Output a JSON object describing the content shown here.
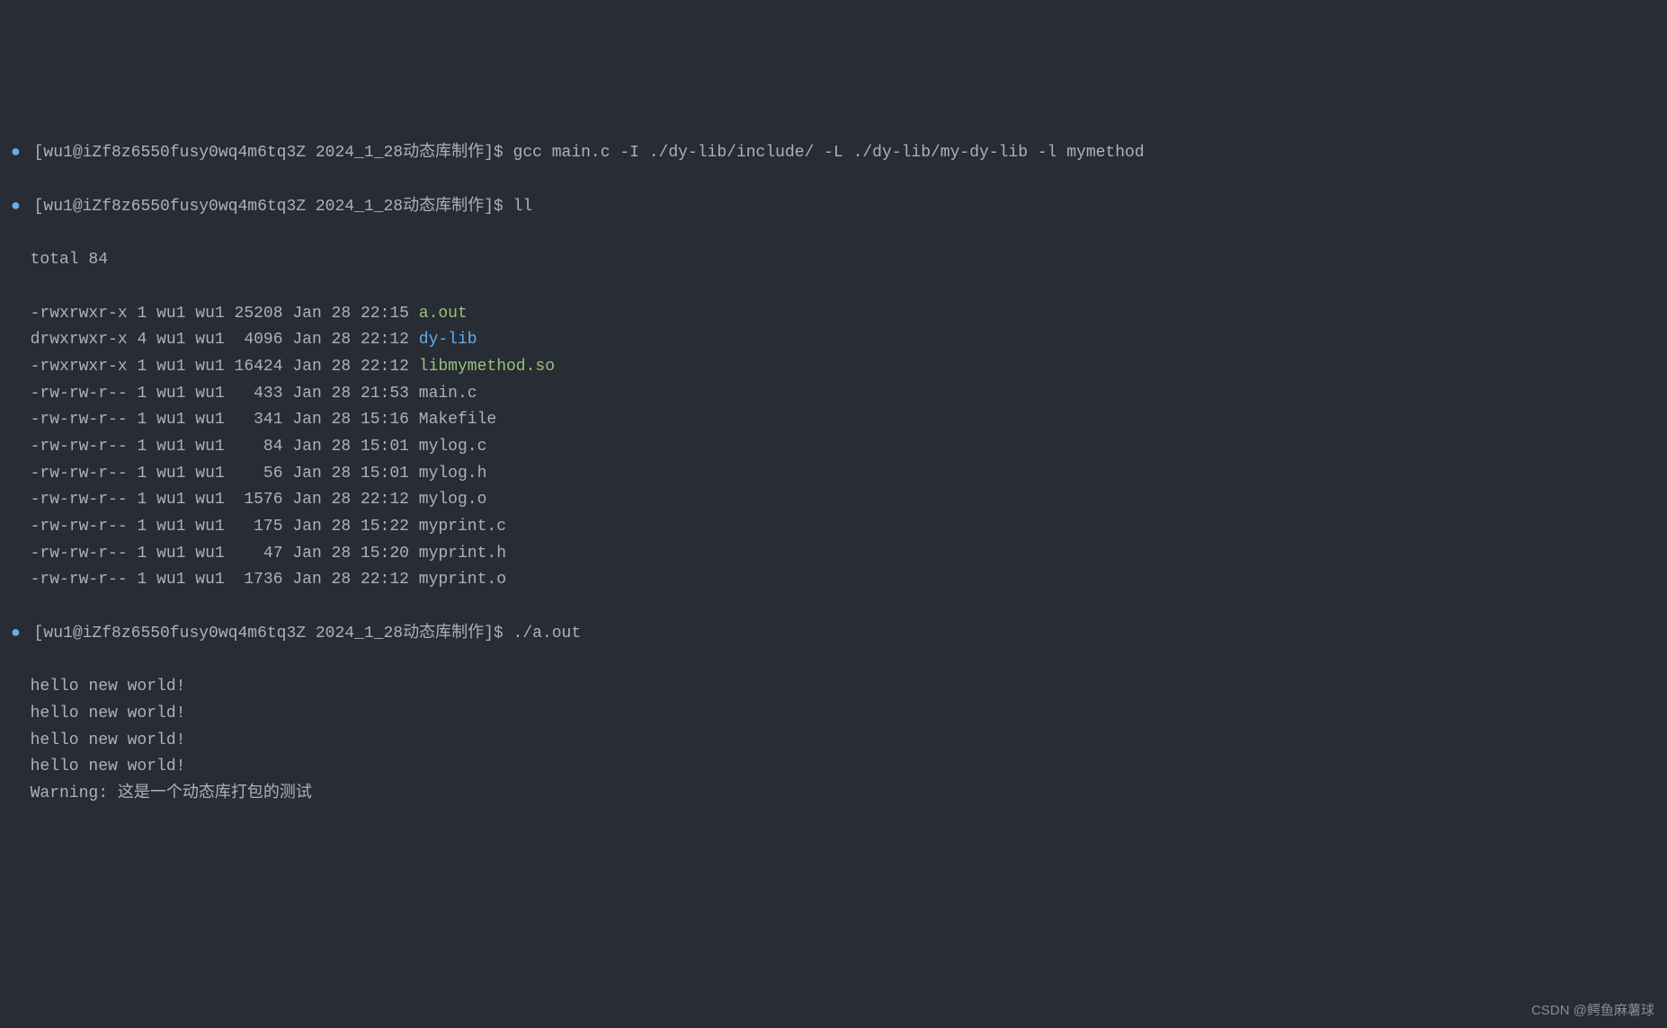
{
  "bullet": "●",
  "prompt": "[wu1@iZf8z6550fusy0wq4m6tq3Z 2024_1_28动态库制作]$",
  "commands": {
    "gcc": "gcc main.c -I ./dy-lib/include/ -L ./dy-lib/my-dy-lib -l mymethod",
    "ll": "ll",
    "run": "./a.out"
  },
  "total": "total 84",
  "files": [
    {
      "perm": "-rwxrwxr-x",
      "links": "1",
      "owner": "wu1",
      "group": "wu1",
      "size": "25208",
      "date": "Jan 28 22:15",
      "name": "a.out",
      "type": "exec"
    },
    {
      "perm": "drwxrwxr-x",
      "links": "4",
      "owner": "wu1",
      "group": "wu1",
      "size": " 4096",
      "date": "Jan 28 22:12",
      "name": "dy-lib",
      "type": "dir"
    },
    {
      "perm": "-rwxrwxr-x",
      "links": "1",
      "owner": "wu1",
      "group": "wu1",
      "size": "16424",
      "date": "Jan 28 22:12",
      "name": "libmymethod.so",
      "type": "exec"
    },
    {
      "perm": "-rw-rw-r--",
      "links": "1",
      "owner": "wu1",
      "group": "wu1",
      "size": "  433",
      "date": "Jan 28 21:53",
      "name": "main.c",
      "type": "normal"
    },
    {
      "perm": "-rw-rw-r--",
      "links": "1",
      "owner": "wu1",
      "group": "wu1",
      "size": "  341",
      "date": "Jan 28 15:16",
      "name": "Makefile",
      "type": "normal"
    },
    {
      "perm": "-rw-rw-r--",
      "links": "1",
      "owner": "wu1",
      "group": "wu1",
      "size": "   84",
      "date": "Jan 28 15:01",
      "name": "mylog.c",
      "type": "normal"
    },
    {
      "perm": "-rw-rw-r--",
      "links": "1",
      "owner": "wu1",
      "group": "wu1",
      "size": "   56",
      "date": "Jan 28 15:01",
      "name": "mylog.h",
      "type": "normal"
    },
    {
      "perm": "-rw-rw-r--",
      "links": "1",
      "owner": "wu1",
      "group": "wu1",
      "size": " 1576",
      "date": "Jan 28 22:12",
      "name": "mylog.o",
      "type": "normal"
    },
    {
      "perm": "-rw-rw-r--",
      "links": "1",
      "owner": "wu1",
      "group": "wu1",
      "size": "  175",
      "date": "Jan 28 15:22",
      "name": "myprint.c",
      "type": "normal"
    },
    {
      "perm": "-rw-rw-r--",
      "links": "1",
      "owner": "wu1",
      "group": "wu1",
      "size": "   47",
      "date": "Jan 28 15:20",
      "name": "myprint.h",
      "type": "normal"
    },
    {
      "perm": "-rw-rw-r--",
      "links": "1",
      "owner": "wu1",
      "group": "wu1",
      "size": " 1736",
      "date": "Jan 28 22:12",
      "name": "myprint.o",
      "type": "normal"
    }
  ],
  "output": [
    "hello new world!",
    "hello new world!",
    "hello new world!",
    "hello new world!",
    "Warning: 这是一个动态库打包的测试"
  ],
  "watermark": "CSDN @鳄鱼麻薯球"
}
